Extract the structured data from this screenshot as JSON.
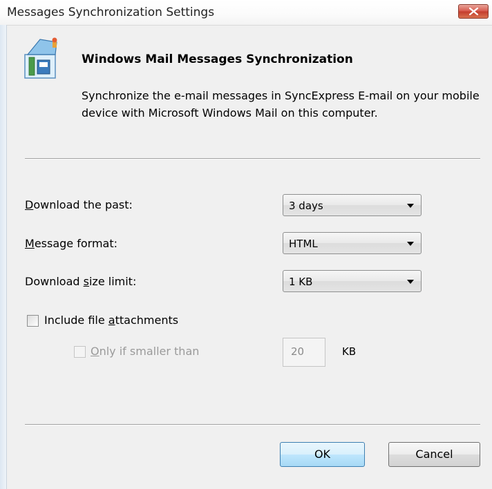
{
  "window": {
    "title": "Messages Synchronization Settings"
  },
  "header": {
    "heading": "Windows Mail Messages Synchronization",
    "description": "Synchronize the e-mail messages in SyncExpress E-mail on your mobile device with Microsoft Windows Mail on this computer.",
    "icon": "windows-mail-icon"
  },
  "settings": {
    "download_past": {
      "label_mnemonic": "D",
      "label_rest": "ownload the past:",
      "value": "3 days"
    },
    "message_format": {
      "label_mnemonic": "M",
      "label_rest": "essage format:",
      "value": "HTML"
    },
    "size_limit": {
      "label_before": "Download ",
      "label_mnemonic": "s",
      "label_rest": "ize limit:",
      "value": "1 KB"
    }
  },
  "attachments": {
    "include": {
      "label_before": "Include file ",
      "label_mnemonic": "a",
      "label_rest": "ttachments",
      "checked": false
    },
    "only_if_smaller": {
      "label_mnemonic": "O",
      "label_rest": "nly if smaller than",
      "checked": false,
      "enabled": false
    },
    "size_value": "20",
    "size_unit": "KB"
  },
  "buttons": {
    "ok": "OK",
    "cancel": "Cancel"
  },
  "colors": {
    "close_button": "#d7564a",
    "ok_border": "#3c7fb1"
  }
}
